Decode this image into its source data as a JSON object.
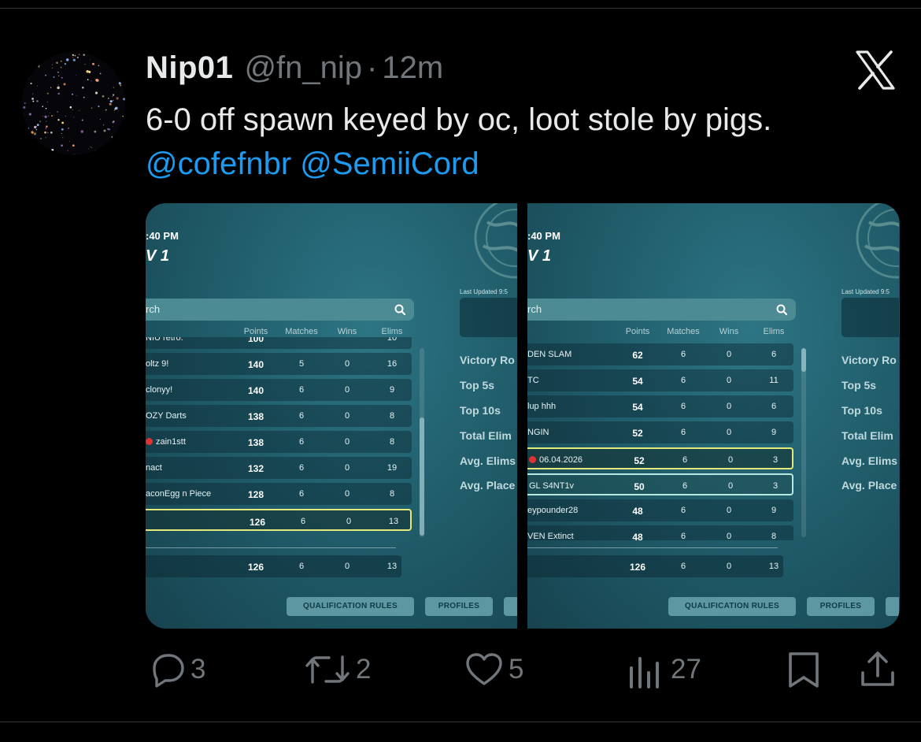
{
  "tweet": {
    "author_name": "Nip01",
    "handle": "@fn_nip",
    "separator": "·",
    "time": "12m",
    "text": "6-0 off spawn keyed by oc, loot stole by pigs.",
    "mentions": [
      "@cofefnbr",
      "@SemiiCord"
    ]
  },
  "media": {
    "panels": [
      {
        "time": ":40 PM",
        "title": "V 1",
        "search_text": "rch",
        "headers": [
          "Points",
          "Matches",
          "Wins",
          "Elims"
        ],
        "rows": [
          {
            "name": "NIU retro.",
            "points": "100",
            "matches": "",
            "wins": "",
            "elims": "10",
            "flag": false,
            "hl": ""
          },
          {
            "name": "oltz 9!",
            "points": "140",
            "matches": "5",
            "wins": "0",
            "elims": "16",
            "flag": false,
            "hl": ""
          },
          {
            "name": "clonyy!",
            "points": "140",
            "matches": "6",
            "wins": "0",
            "elims": "9",
            "flag": false,
            "hl": ""
          },
          {
            "name": "OZY Darts",
            "points": "138",
            "matches": "6",
            "wins": "0",
            "elims": "8",
            "flag": false,
            "hl": ""
          },
          {
            "name": "zain1stt",
            "points": "138",
            "matches": "6",
            "wins": "0",
            "elims": "8",
            "flag": true,
            "hl": ""
          },
          {
            "name": "nact",
            "points": "132",
            "matches": "6",
            "wins": "0",
            "elims": "19",
            "flag": false,
            "hl": ""
          },
          {
            "name": "aconEgg n Piece",
            "points": "128",
            "matches": "6",
            "wins": "0",
            "elims": "8",
            "flag": false,
            "hl": ""
          },
          {
            "name": "",
            "points": "126",
            "matches": "6",
            "wins": "0",
            "elims": "13",
            "flag": false,
            "hl": "yellow"
          }
        ],
        "summary": {
          "points": "126",
          "matches": "6",
          "wins": "0",
          "elims": "13"
        },
        "last_updated": "Last Updated 9:5",
        "stats": [
          "Victory Ro",
          "Top 5s",
          "Top 10s",
          "Total Elim",
          "Avg. Elims",
          "Avg. Place"
        ],
        "buttons": [
          "QUALIFICATION RULES",
          "PROFILES"
        ]
      },
      {
        "time": ":40 PM",
        "title": "V 1",
        "search_text": "rch",
        "headers": [
          "Points",
          "Matches",
          "Wins",
          "Elims"
        ],
        "rows": [
          {
            "name": "DEN SLAM",
            "points": "62",
            "matches": "6",
            "wins": "0",
            "elims": "6",
            "flag": false,
            "hl": ""
          },
          {
            "name": "TC",
            "points": "54",
            "matches": "6",
            "wins": "0",
            "elims": "11",
            "flag": false,
            "hl": ""
          },
          {
            "name": "lup hhh",
            "points": "54",
            "matches": "6",
            "wins": "0",
            "elims": "6",
            "flag": false,
            "hl": ""
          },
          {
            "name": "NGIN",
            "points": "52",
            "matches": "6",
            "wins": "0",
            "elims": "9",
            "flag": false,
            "hl": ""
          },
          {
            "name": "06.04.2026",
            "points": "52",
            "matches": "6",
            "wins": "0",
            "elims": "3",
            "flag": true,
            "hl": "yellow"
          },
          {
            "name": "GL S4NT1v",
            "points": "50",
            "matches": "6",
            "wins": "0",
            "elims": "3",
            "flag": false,
            "hl": "white"
          },
          {
            "name": "eypounder28",
            "points": "48",
            "matches": "6",
            "wins": "0",
            "elims": "9",
            "flag": false,
            "hl": ""
          },
          {
            "name": "VEN Extinct",
            "points": "48",
            "matches": "6",
            "wins": "0",
            "elims": "8",
            "flag": false,
            "hl": ""
          }
        ],
        "summary": {
          "points": "126",
          "matches": "6",
          "wins": "0",
          "elims": "13"
        },
        "last_updated": "Last Updated 9:5",
        "stats": [
          "Victory Ro",
          "Top 5s",
          "Top 10s",
          "Total Elim",
          "Avg. Elims",
          "Avg. Place"
        ],
        "buttons": [
          "QUALIFICATION RULES",
          "PROFILES"
        ]
      }
    ]
  },
  "actions": {
    "replies": "3",
    "reposts": "2",
    "likes": "5",
    "views": "27"
  },
  "colors": {
    "background": "#000000",
    "text": "#e7e9ea",
    "muted": "#71767b",
    "link": "#1d9bf0"
  }
}
